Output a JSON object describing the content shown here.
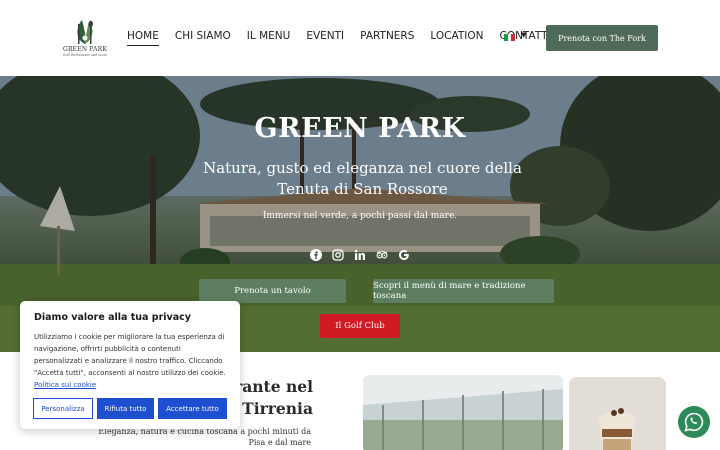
{
  "brand": {
    "name": "GREEN PARK",
    "tagline": "Golf Restaurant and more"
  },
  "nav": {
    "items": [
      {
        "label": "HOME",
        "active": true
      },
      {
        "label": "CHI SIAMO",
        "active": false
      },
      {
        "label": "IL MENU",
        "active": false
      },
      {
        "label": "EVENTI",
        "active": false
      },
      {
        "label": "PARTNERS",
        "active": false
      },
      {
        "label": "LOCATION",
        "active": false
      },
      {
        "label": "CONTATTI",
        "active": false
      }
    ],
    "language_icon": "italy-flag-icon"
  },
  "header": {
    "cta_label": "Prenota con The Fork"
  },
  "hero": {
    "title": "GREEN PARK",
    "subtitle": "Natura, gusto ed eleganza nel cuore della Tenuta di San Rossore",
    "tagline": "Immersi nel verde, a pochi passi dal mare.",
    "socials": [
      "facebook-icon",
      "instagram-icon",
      "linkedin-icon",
      "tripadvisor-icon",
      "google-icon"
    ],
    "buttons": {
      "table": "Prenota un tavolo",
      "menu": "Scopri il menù di mare e tradizione toscana",
      "golf": "Il Golf Club"
    }
  },
  "intro": {
    "title_line1": "...rante nel",
    "title_line2": "...o Tirrenia",
    "desc": "Eleganza, natura e cucina toscana a pochi minuti da Pisa e dal mare"
  },
  "cookie": {
    "title": "Diamo valore alla tua privacy",
    "text": "Utilizziamo i cookie per migliorare la tua esperienza di navigazione, offrirti pubblicità o contenuti personalizzati e analizzare il nostro traffico. Cliccando \"Accetta tutti\", acconsenti al nostro utilizzo dei cookie.",
    "link": "Politica sui cookie",
    "buttons": {
      "customize": "Personalizza",
      "reject": "Rifiuta tutto",
      "accept": "Accettare tutto"
    }
  },
  "colors": {
    "brand_green": "#4f6b57",
    "golf_red": "#d11b24",
    "cookie_blue": "#1f4fd1",
    "whatsapp_green": "#2e8a58"
  }
}
